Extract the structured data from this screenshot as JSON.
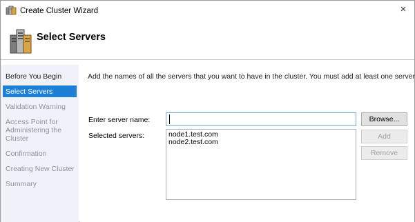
{
  "window": {
    "title": "Create Cluster Wizard",
    "close_glyph": "×",
    "icon": "cluster-wizard-icon"
  },
  "header": {
    "title": "Select Servers",
    "icon": "servers-icon"
  },
  "sidebar": {
    "steps": [
      {
        "label": "Before You Begin",
        "state": "done"
      },
      {
        "label": "Select Servers",
        "state": "active"
      },
      {
        "label": "Validation Warning",
        "state": "pending"
      },
      {
        "label": "Access Point for Administering the Cluster",
        "state": "pending"
      },
      {
        "label": "Confirmation",
        "state": "pending"
      },
      {
        "label": "Creating New Cluster",
        "state": "pending"
      },
      {
        "label": "Summary",
        "state": "pending"
      }
    ]
  },
  "main": {
    "intro": "Add the names of all the servers that you want to have in the cluster. You must add at least one server.",
    "server_name_label": "Enter server name:",
    "server_name_value": "",
    "selected_label": "Selected servers:",
    "selected_servers": [
      "node1.test.com",
      "node2.test.com"
    ],
    "buttons": {
      "browse": "Browse...",
      "add": "Add",
      "remove": "Remove"
    }
  },
  "colors": {
    "accent": "#1d7fd6",
    "sidebar_bg": "#eff3f9",
    "inactive_step": "#8d9399"
  }
}
